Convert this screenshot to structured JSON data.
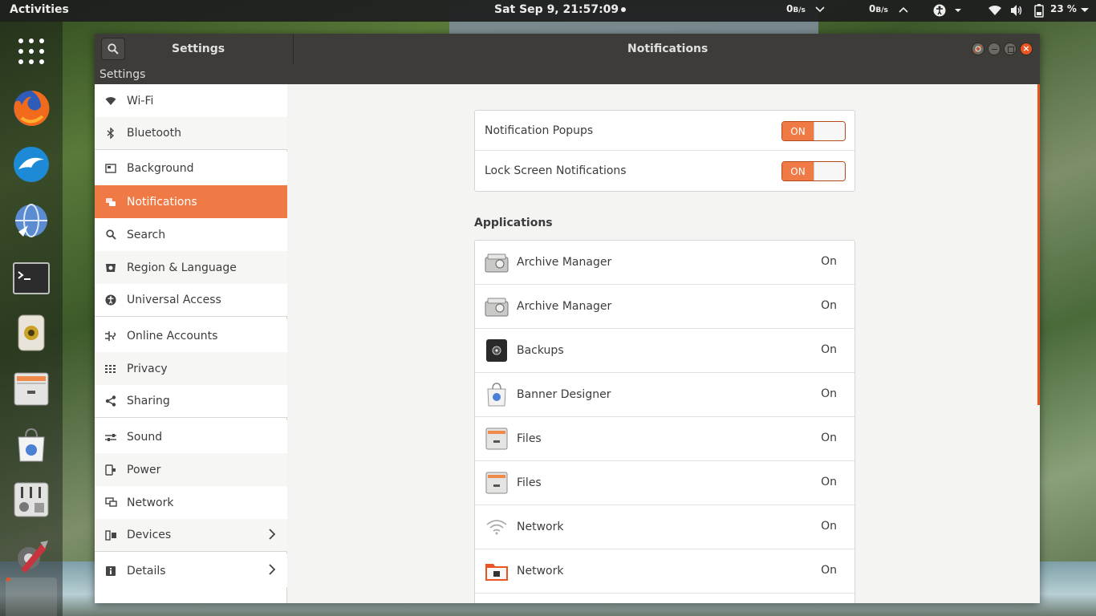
{
  "topbar": {
    "activities": "Activities",
    "clock": "Sat Sep  9, 21:57:09",
    "net_down": "0",
    "net_down_unit": "B/s",
    "net_up": "0",
    "net_up_unit": "B/s",
    "battery": "23 %"
  },
  "dock": {
    "items": [
      "app-grid-icon",
      "firefox-icon",
      "browser-icon",
      "globe-icon",
      "terminal-icon",
      "speaker-icon",
      "files-icon",
      "software-icon",
      "mixer-icon",
      "settings-icon"
    ]
  },
  "window": {
    "left_title": "Settings",
    "title": "Notifications",
    "menu": "Settings"
  },
  "sidebar": {
    "items": [
      {
        "label": "Wi-Fi",
        "icon": "wifi-icon"
      },
      {
        "label": "Bluetooth",
        "icon": "bluetooth-icon"
      },
      {
        "label": "Background",
        "icon": "background-icon"
      },
      {
        "label": "Notifications",
        "icon": "notifications-icon"
      },
      {
        "label": "Search",
        "icon": "search-icon"
      },
      {
        "label": "Region & Language",
        "icon": "region-icon"
      },
      {
        "label": "Universal Access",
        "icon": "accessibility-icon"
      },
      {
        "label": "Online Accounts",
        "icon": "online-accounts-icon"
      },
      {
        "label": "Privacy",
        "icon": "privacy-icon"
      },
      {
        "label": "Sharing",
        "icon": "share-icon"
      },
      {
        "label": "Sound",
        "icon": "sound-icon"
      },
      {
        "label": "Power",
        "icon": "power-icon"
      },
      {
        "label": "Network",
        "icon": "network-icon"
      },
      {
        "label": "Devices",
        "icon": "devices-icon"
      },
      {
        "label": "Details",
        "icon": "details-icon"
      }
    ],
    "active": "Notifications"
  },
  "settings": {
    "popups_label": "Notification Popups",
    "popups_state": "ON",
    "lock_label": "Lock Screen Notifications",
    "lock_state": "ON"
  },
  "applications": {
    "title": "Applications",
    "items": [
      {
        "name": "Archive Manager",
        "status": "On",
        "icon": "archive-manager-icon"
      },
      {
        "name": "Archive Manager",
        "status": "On",
        "icon": "archive-manager-icon"
      },
      {
        "name": "Backups",
        "status": "On",
        "icon": "backups-icon"
      },
      {
        "name": "Banner Designer",
        "status": "On",
        "icon": "banner-designer-icon"
      },
      {
        "name": "Files",
        "status": "On",
        "icon": "files-icon"
      },
      {
        "name": "Files",
        "status": "On",
        "icon": "files-icon"
      },
      {
        "name": "Network",
        "status": "On",
        "icon": "network-wifi-icon"
      },
      {
        "name": "Network",
        "status": "On",
        "icon": "network-folder-icon"
      }
    ]
  },
  "colors": {
    "accent": "#e95420",
    "active_row": "#ef7a45",
    "headerbar": "#3d3c38"
  }
}
